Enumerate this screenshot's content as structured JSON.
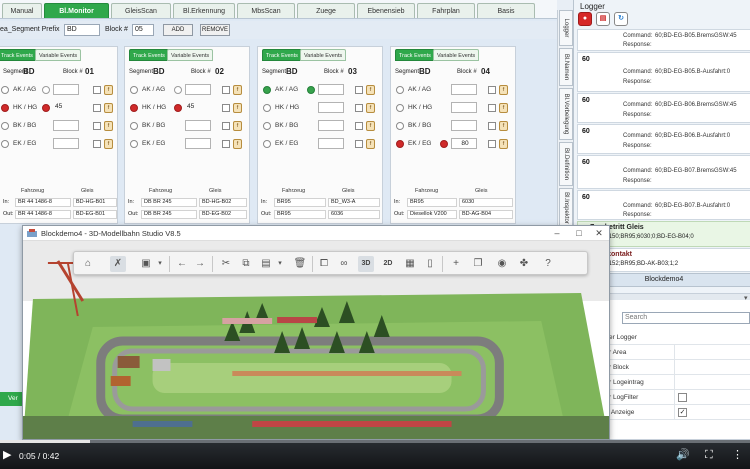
{
  "tabs": [
    "Manual",
    "Bl.Monitor",
    "GleisScan",
    "Bl.Erkennung",
    "MbsScan",
    "Zuege",
    "Ebenensieb",
    "Fahrplan",
    "Basis"
  ],
  "active_tab": "Bl.Monitor",
  "prefix_bar": {
    "prefix_label": "ea_Segment Prefix",
    "prefix_value": "BD",
    "block_label": "Block #",
    "block_value": "05",
    "add_label": "ADD",
    "remove_label": "REMOVE"
  },
  "panel_tabs": {
    "track": "Track Events",
    "variable": "Variable Events"
  },
  "panel_common": {
    "segment_label": "Segment:",
    "block_label": "Block #",
    "row_labels": [
      "AK / AG",
      "HK / HG",
      "BK / BG",
      "EK / EG"
    ],
    "fahrzeug_header": "Fahrzeug",
    "gleis_header": "Gleis",
    "in_label": "In:",
    "out_label": "Out:",
    "fbtn": "f"
  },
  "panels": [
    {
      "segment": "BD",
      "block": "01",
      "value_hk": "45",
      "value_ek": "",
      "in_fahrzeug": "BR 44 1486-8",
      "in_gleis": "BD-HG-B01",
      "out_fahrzeug": "BR 44 1486-8",
      "out_gleis": "BD-EG-B01"
    },
    {
      "segment": "BD",
      "block": "02",
      "value_hk": "45",
      "value_ek": "",
      "in_fahrzeug": "DB BR 245",
      "in_gleis": "BD-HG-B02",
      "out_fahrzeug": "DB BR 245",
      "out_gleis": "BD-EG-B02"
    },
    {
      "segment": "BD",
      "block": "03",
      "value_hk": "",
      "value_ek": "",
      "in_fahrzeug": "BR95",
      "in_gleis": "BD_W3-A",
      "out_fahrzeug": "BR95",
      "out_gleis": "6036"
    },
    {
      "segment": "BD",
      "block": "04",
      "value_hk": "",
      "value_ek": "80",
      "in_fahrzeug": "BR95",
      "in_gleis": "6030",
      "out_fahrzeug": "Diesellok V200",
      "out_gleis": "BD-AG-B04"
    }
  ],
  "side_tabs": [
    "Logger",
    "Bl.Namen",
    "Bl.Vorbelegung",
    "Bl.Definition",
    "Bl.Inspektor"
  ],
  "logger": {
    "title": "Logger",
    "command_label": "Command:",
    "response_label": "Response:",
    "entries": [
      {
        "num": "",
        "command": "60;BD-EG-B05.BremsGSW:45"
      },
      {
        "num": "60",
        "command": "60;BD-EG-B05.B-Ausfahrt:0"
      },
      {
        "num": "60",
        "command": "60;BD-EG-B06.BremsGSW:45"
      },
      {
        "num": "60",
        "command": "60;BD-EG-B06.B-Ausfahrt:0"
      },
      {
        "num": "60",
        "command": "60;BD-EG-B07.BremsGSW:45"
      },
      {
        "num": "60",
        "command": "60;BD-EG-B07.B-Ausfahrt:0"
      }
    ],
    "events": [
      {
        "title": "Zug betritt Gleis",
        "event": "Event:  150;BR95;6030;0;BD-EG-B04;0"
      },
      {
        "title": "Gleiskontakt",
        "event": "Event:  152;BR95;BD-AK-B03;1;2"
      }
    ],
    "blockdemo_tab": "Blockdemo4"
  },
  "properties": {
    "search_placeholder": "Search",
    "rows": [
      "neter Logger",
      "fuer Area",
      "fuer Block",
      "fuer Logeintrag",
      "fuer LogFilter",
      "ere Anzeige"
    ],
    "checks": [
      false,
      false,
      false,
      false,
      false,
      true
    ]
  },
  "studio": {
    "title": "Blockdemo4 - 3D-Modellbahn Studio V8.5",
    "toolbar_3d": "3D",
    "toolbar_2d": "2D",
    "help": "?"
  },
  "partial_tab": "Ver",
  "player": {
    "time": "0:05 / 0:42",
    "progress": 0.12
  },
  "colors": {
    "tab_active": "#2fa84b",
    "lamp_red": "#d02a2a",
    "lamp_green": "#37a24c",
    "event_bg": "#e9f6e5"
  }
}
